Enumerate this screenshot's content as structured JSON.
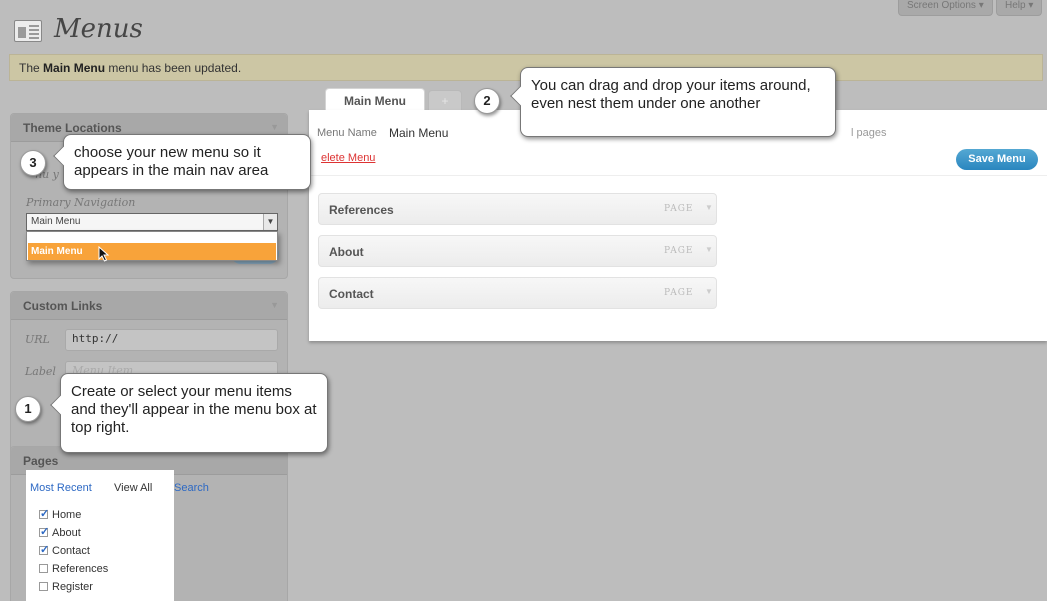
{
  "header": {
    "title": "Menus",
    "screen_options": "Screen Options",
    "help": "Help"
  },
  "notice": {
    "prefix": "The",
    "menu_name": "Main Menu",
    "suffix": "menu has been updated."
  },
  "theme_locations": {
    "heading": "Theme Locations",
    "intro_fragment": "nu y",
    "location_label": "Primary Navigation",
    "selected": "Main Menu",
    "options": [
      "Main Menu"
    ]
  },
  "custom_links": {
    "heading": "Custom Links",
    "url_label": "URL",
    "url_value": "http://",
    "label_label": "Label",
    "label_placeholder": "Menu Item"
  },
  "pages": {
    "heading": "Pages",
    "tabs": [
      "Most Recent",
      "View All",
      "Search"
    ],
    "items": [
      {
        "label": "Home",
        "checked": true
      },
      {
        "label": "About",
        "checked": true
      },
      {
        "label": "Contact",
        "checked": true
      },
      {
        "label": "References",
        "checked": false
      },
      {
        "label": "Register",
        "checked": false
      }
    ]
  },
  "menu_editor": {
    "tab_label": "Main Menu",
    "add_tab": "+",
    "menu_name_label": "Menu Name",
    "menu_name_value": "Main Menu",
    "auto_add_fragment": "l pages",
    "delete_label": "elete Menu",
    "save_label": "Save Menu",
    "items": [
      {
        "title": "References",
        "type": "PAGE"
      },
      {
        "title": "About",
        "type": "PAGE"
      },
      {
        "title": "Contact",
        "type": "PAGE"
      }
    ]
  },
  "callouts": [
    {
      "number": "1",
      "text": "Create or select your menu items and they'll appear in the menu box at top right."
    },
    {
      "number": "2",
      "text": "You can drag and drop your items around, even nest them under one another"
    },
    {
      "number": "3",
      "text": "choose your new menu so it appears in the main nav area"
    }
  ],
  "icons": {
    "page_icon": "menus-screen-icon",
    "dropdown": "chevron-down-icon",
    "cursor": "mouse-pointer-icon"
  },
  "colors": {
    "highlight": "#f8a33a",
    "save_button": "#2a86bf",
    "link": "#2d69c4",
    "delete": "#dd3333"
  }
}
